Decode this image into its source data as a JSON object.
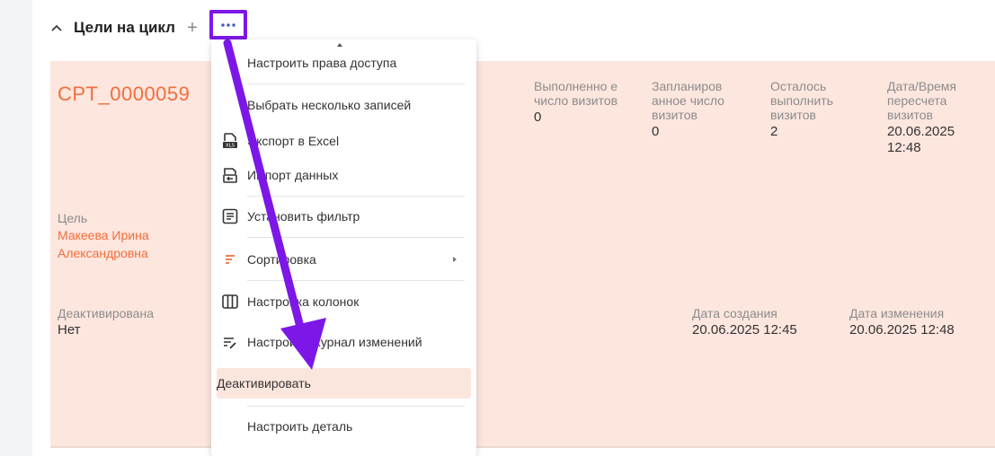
{
  "section": {
    "title": "Цели на цикл",
    "add_label": "+"
  },
  "card": {
    "code": "CPT_0000059",
    "stats": [
      {
        "label": "Выполненно е число визитов",
        "value": "0"
      },
      {
        "label": "Запланиров анное число визитов",
        "value": "0"
      },
      {
        "label": "Осталось выполнить визитов",
        "value": "2"
      },
      {
        "label": "Дата/Время пересчета визитов",
        "value": "20.06.2025 12:48"
      }
    ],
    "goal_label": "Цель",
    "goal_value": "Макеева Ирина Александровна",
    "deactivated_label": "Деактивирована",
    "deactivated_value": "Нет",
    "created_label": "Дата создания",
    "created_value": "20.06.2025 12:45",
    "modified_label": "Дата изменения",
    "modified_value": "20.06.2025 12:48"
  },
  "menu": {
    "items": [
      {
        "label": "Настроить права доступа",
        "icon": "none"
      },
      {
        "label": "Выбрать несколько записей",
        "icon": "none"
      },
      {
        "label": "Экспорт в Excel",
        "icon": "xls-export-icon"
      },
      {
        "label": "Импорт данных",
        "icon": "import-icon"
      },
      {
        "label": "Установить фильтр",
        "icon": "filter-icon"
      },
      {
        "label": "Сортировка",
        "icon": "sort-icon"
      },
      {
        "label": "Настройка колонок",
        "icon": "columns-icon"
      },
      {
        "label": "Настроить журнал изменений",
        "icon": "changelog-icon"
      },
      {
        "label": "Деактивировать",
        "icon": "none"
      },
      {
        "label": "Настроить деталь",
        "icon": "none"
      }
    ],
    "xls_badge": "XLS"
  },
  "colors": {
    "accent": "#f26d3d",
    "highlight": "#7c17e8",
    "card_bg": "#fde6de",
    "menu_active_bg": "#fbe6de"
  }
}
